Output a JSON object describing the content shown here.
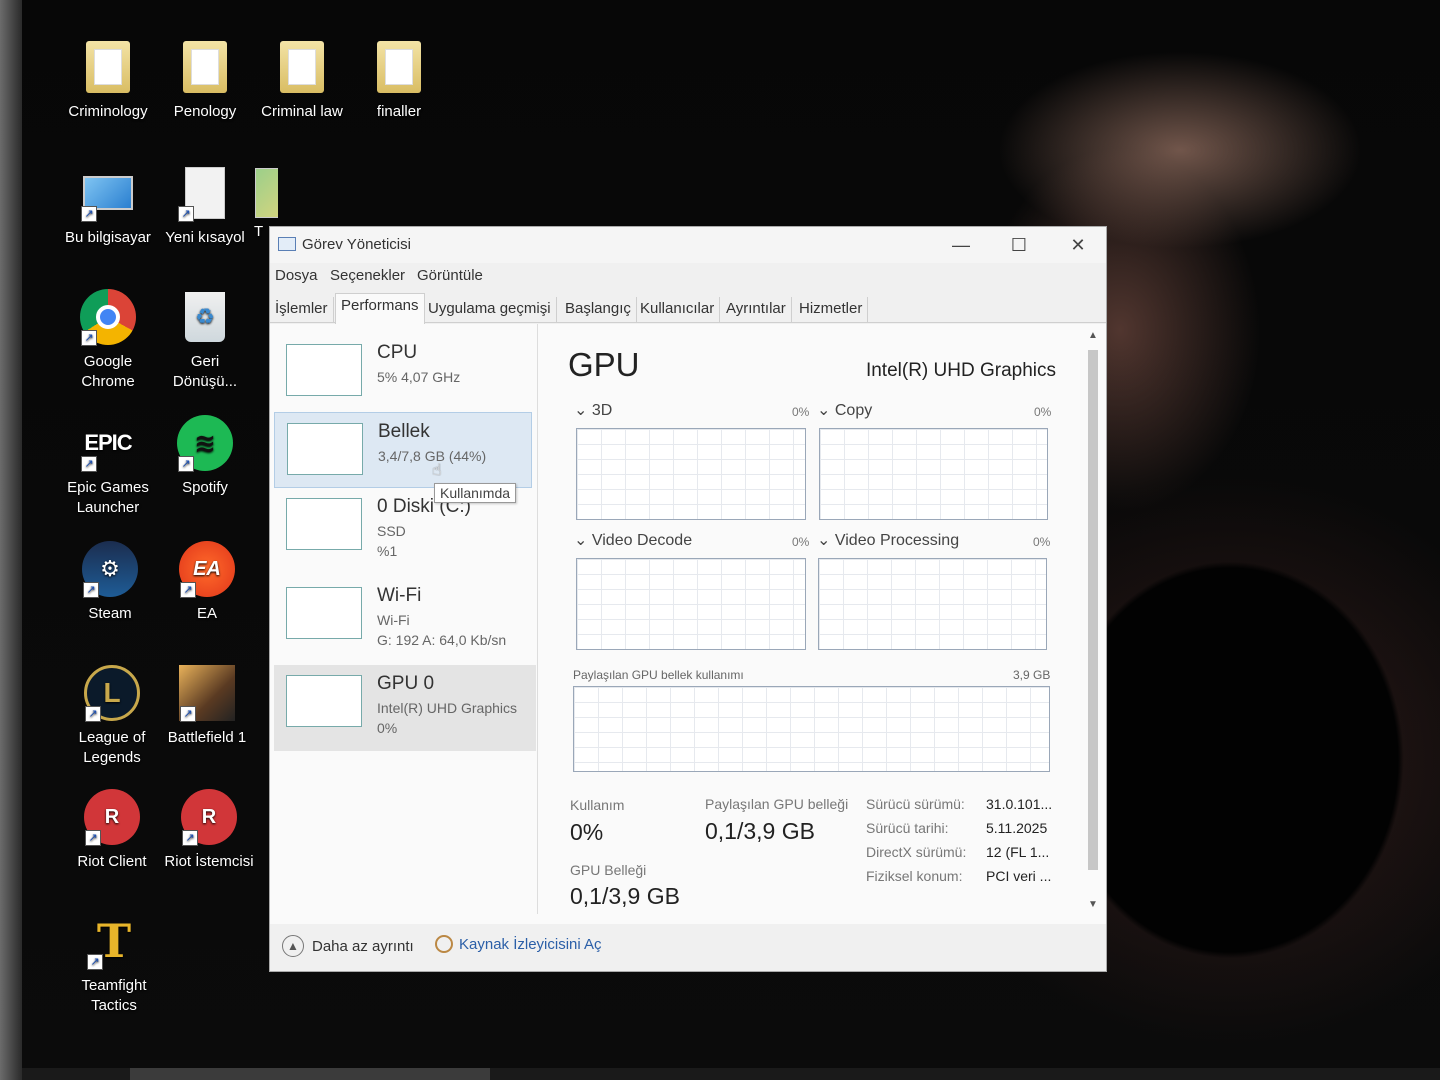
{
  "desktop": {
    "icons": [
      {
        "label": "Criminology",
        "icon": "folder-icon"
      },
      {
        "label": "Penology",
        "icon": "folder-icon"
      },
      {
        "label": "Criminal law",
        "icon": "folder-icon"
      },
      {
        "label": "finaller",
        "icon": "folder-icon"
      },
      {
        "label": "Bu bilgisayar",
        "icon": "computer-icon"
      },
      {
        "label": "Yeni kısayol",
        "icon": "file-icon"
      },
      {
        "label": "T",
        "icon": "shield-icon"
      },
      {
        "label": "Google Chrome",
        "icon": "chrome-icon"
      },
      {
        "label": "Geri Dönüşü...",
        "icon": "recycle-bin-icon"
      },
      {
        "label": "Epic Games Launcher",
        "icon": "epic-games-icon",
        "glyph": "EPIC"
      },
      {
        "label": "Spotify",
        "icon": "spotify-icon"
      },
      {
        "label": "Steam",
        "icon": "steam-icon"
      },
      {
        "label": "EA",
        "icon": "ea-icon",
        "glyph": "EA"
      },
      {
        "label": "League of Legends",
        "icon": "league-icon",
        "glyph": "L"
      },
      {
        "label": "Battlefield 1",
        "icon": "battlefield-icon"
      },
      {
        "label": "Riot Client",
        "icon": "riot-icon",
        "glyph": "R"
      },
      {
        "label": "Riot İstemcisi",
        "icon": "riot-icon",
        "glyph": "R"
      },
      {
        "label": "Teamfight Tactics",
        "icon": "tft-icon",
        "glyph": "T"
      }
    ]
  },
  "window": {
    "title": "Görev Yöneticisi",
    "controls": {
      "minimize": "—",
      "maximize": "☐",
      "close": "✕"
    },
    "menu": [
      "Dosya",
      "Seçenekler",
      "Görüntüle"
    ],
    "tabs": [
      "İşlemler",
      "Performans",
      "Uygulama geçmişi",
      "Başlangıç",
      "Kullanıcılar",
      "Ayrıntılar",
      "Hizmetler"
    ],
    "active_tab": "Performans"
  },
  "resources": [
    {
      "name": "CPU",
      "line1": "5%  4,07 GHz",
      "line2": ""
    },
    {
      "name": "Bellek",
      "line1": "3,4/7,8 GB (44%)",
      "line2": ""
    },
    {
      "name": "0 Diski (C:)",
      "line1": "SSD",
      "line2": "%1"
    },
    {
      "name": "Wi-Fi",
      "line1": "Wi-Fi",
      "line2": "G: 192  A: 64,0 Kb/sn"
    },
    {
      "name": "GPU 0",
      "line1": "Intel(R) UHD Graphics",
      "line2": "0%"
    }
  ],
  "tooltip": "Kullanımda",
  "gpu": {
    "title": "GPU",
    "model": "Intel(R) UHD Graphics",
    "engines": [
      {
        "label": "3D",
        "pct": "0%"
      },
      {
        "label": "Copy",
        "pct": "0%"
      },
      {
        "label": "Video Decode",
        "pct": "0%"
      },
      {
        "label": "Video Processing",
        "pct": "0%"
      }
    ],
    "shared_label": "Paylaşılan GPU bellek kullanımı",
    "shared_max": "3,9 GB",
    "stats": {
      "usage_label": "Kullanım",
      "usage_value": "0%",
      "shared_mem_label": "Paylaşılan GPU belleği",
      "shared_mem_value": "0,1/3,9 GB",
      "gpu_mem_label": "GPU Belleği",
      "gpu_mem_value": "0,1/3,9 GB"
    },
    "props": [
      {
        "label": "Sürücü sürümü:",
        "value": "31.0.101..."
      },
      {
        "label": "Sürücü tarihi:",
        "value": "5.11.2025"
      },
      {
        "label": "DirectX sürümü:",
        "value": "12 (FL 1..."
      },
      {
        "label": "Fiziksel konum:",
        "value": "PCI veri ..."
      }
    ]
  },
  "footer": {
    "less_details": "Daha az ayrıntı",
    "resource_monitor": "Kaynak İzleyicisini Aç"
  }
}
